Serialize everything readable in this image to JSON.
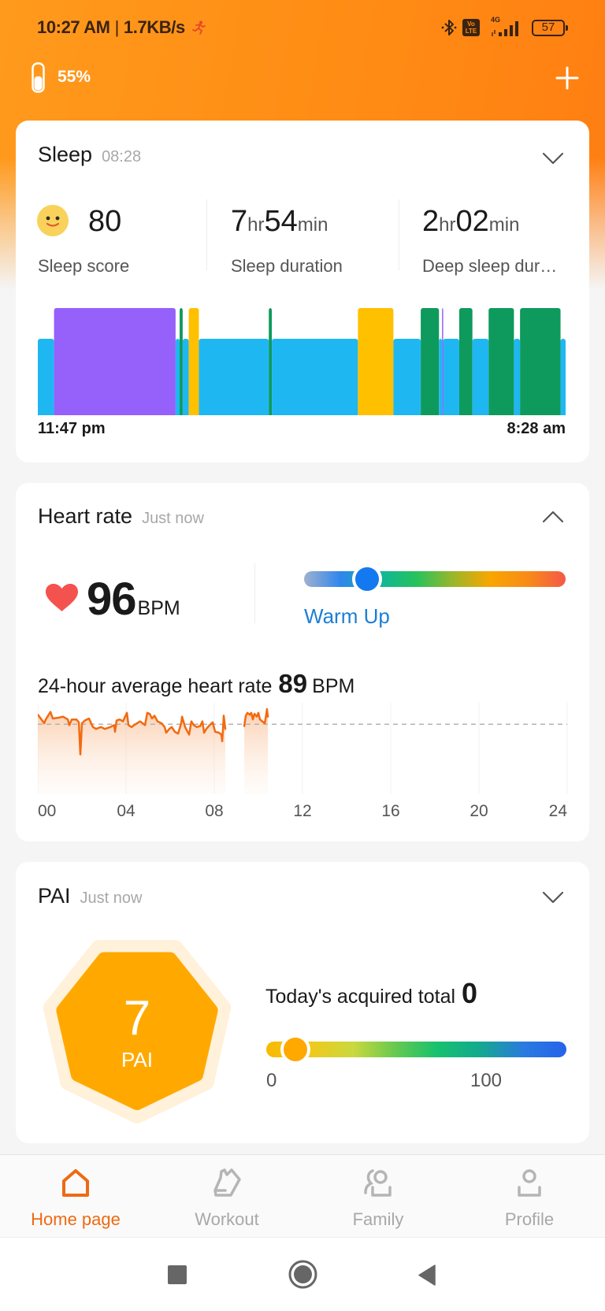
{
  "status_bar": {
    "time": "10:27 AM",
    "separator": "|",
    "net_speed": "1.7KB/s",
    "volte_top": "Vo",
    "volte_bottom": "LTE",
    "network_type": "4G",
    "battery_level": "57"
  },
  "header": {
    "band_battery": "55%",
    "band_battery_fraction": 0.55
  },
  "sleep": {
    "title": "Sleep",
    "time": "08:28",
    "score": {
      "value": "80",
      "label": "Sleep score"
    },
    "duration": {
      "hours": "7",
      "hours_unit": "hr",
      "minutes": "54",
      "minutes_unit": "min",
      "label": "Sleep duration"
    },
    "deep_sleep": {
      "hours": "2",
      "hours_unit": "hr",
      "minutes": "02",
      "minutes_unit": "min",
      "label": "Deep sleep dur…"
    },
    "start_label": "11:47 pm",
    "end_label": "8:28 am"
  },
  "heart_rate": {
    "title": "Heart rate",
    "time": "Just now",
    "value": "96",
    "unit": "BPM",
    "zone": "Warm Up",
    "zone_position": 0.24,
    "avg_label": "24-hour average heart rate",
    "avg_value": "89",
    "avg_unit": "BPM"
  },
  "pai": {
    "title": "PAI",
    "time": "Just now",
    "value": "7",
    "label": "PAI",
    "today_label": "Today's acquired total",
    "today_value": "0",
    "scale_min_label": "0",
    "scale_max_label": "100",
    "scale_max": 100,
    "indicator_value": 7
  },
  "bottom_nav": {
    "items": [
      {
        "label": "Home page",
        "icon": "home-icon",
        "active": true
      },
      {
        "label": "Workout",
        "icon": "shoe-icon",
        "active": false
      },
      {
        "label": "Family",
        "icon": "family-icon",
        "active": false
      },
      {
        "label": "Profile",
        "icon": "profile-icon",
        "active": false
      }
    ]
  },
  "colors": {
    "accent": "#EE6A12",
    "inactive": "#A8A8A8",
    "heart": "#F4524E",
    "zone_text": "#1C7ED6",
    "pai_fill": "#FFA900",
    "pai_halo": "#FFF1DA",
    "hr_line": "#F26A10",
    "zone_gradient": [
      "#9FB1CE",
      "#2E86EE",
      "#0FB69A",
      "#27C25C",
      "#9BB62A",
      "#F9A600",
      "#F88A18",
      "#F4584A"
    ],
    "pai_gradient": [
      "#F7BA00",
      "#F2C81A",
      "#C9D93E",
      "#66C94F",
      "#16C16E",
      "#14A98E",
      "#2A7AE0",
      "#2563EB"
    ]
  },
  "chart_data": [
    {
      "id": "sleep_stages",
      "type": "bar",
      "xlabel": "",
      "ylabel": "",
      "x_start_label": "11:47 pm",
      "x_end_label": "8:28 am",
      "x_range_minutes": [
        0,
        521
      ],
      "stage_colors": {
        "light": "#1FB7F2",
        "deep": "#9660FA",
        "rem": "#0E9A5C",
        "awake": "#FFC000"
      },
      "stage_tier": {
        "light": 1,
        "deep": 2,
        "rem": 2,
        "awake": 2
      },
      "segments": [
        {
          "stage": "light",
          "start": 0,
          "end": 16
        },
        {
          "stage": "deep",
          "start": 16,
          "end": 136
        },
        {
          "stage": "light",
          "start": 136,
          "end": 140
        },
        {
          "stage": "rem",
          "start": 140,
          "end": 143
        },
        {
          "stage": "light",
          "start": 143,
          "end": 149
        },
        {
          "stage": "awake",
          "start": 149,
          "end": 159
        },
        {
          "stage": "light",
          "start": 159,
          "end": 228
        },
        {
          "stage": "rem",
          "start": 228,
          "end": 231
        },
        {
          "stage": "light",
          "start": 231,
          "end": 316
        },
        {
          "stage": "awake",
          "start": 316,
          "end": 351
        },
        {
          "stage": "light",
          "start": 351,
          "end": 378
        },
        {
          "stage": "rem",
          "start": 378,
          "end": 396
        },
        {
          "stage": "light",
          "start": 396,
          "end": 399
        },
        {
          "stage": "deep",
          "start": 399,
          "end": 400
        },
        {
          "stage": "light",
          "start": 400,
          "end": 416
        },
        {
          "stage": "rem",
          "start": 416,
          "end": 429
        },
        {
          "stage": "light",
          "start": 429,
          "end": 445
        },
        {
          "stage": "rem",
          "start": 445,
          "end": 470
        },
        {
          "stage": "light",
          "start": 470,
          "end": 476
        },
        {
          "stage": "rem",
          "start": 476,
          "end": 516
        },
        {
          "stage": "light",
          "start": 516,
          "end": 521
        }
      ]
    },
    {
      "id": "heart_rate_24h",
      "type": "line",
      "xlabel": "",
      "ylabel": "",
      "x_ticks": [
        "00",
        "04",
        "08",
        "12",
        "16",
        "20",
        "24"
      ],
      "xlim": [
        0,
        24
      ],
      "ylim": [
        15,
        115
      ],
      "grid": "vertical",
      "average": 89,
      "series": [
        {
          "name": "Heart rate (BPM)",
          "segments": [
            [
              [
                0.0,
                99
              ],
              [
                0.07,
                97
              ],
              [
                0.29,
                90
              ],
              [
                0.36,
                94
              ],
              [
                0.57,
                102
              ],
              [
                0.68,
                95
              ],
              [
                0.96,
                96
              ],
              [
                1.14,
                97
              ],
              [
                1.36,
                94
              ],
              [
                1.43,
                88
              ],
              [
                1.54,
                94
              ],
              [
                1.75,
                94
              ],
              [
                1.86,
                91
              ],
              [
                1.93,
                57
              ],
              [
                2.0,
                90
              ],
              [
                2.14,
                93
              ],
              [
                2.32,
                95
              ],
              [
                2.5,
                86
              ],
              [
                2.64,
                84
              ],
              [
                2.86,
                86
              ],
              [
                3.04,
                84
              ],
              [
                3.29,
                86
              ],
              [
                3.46,
                88
              ],
              [
                3.5,
                81
              ],
              [
                3.57,
                93
              ],
              [
                3.71,
                94
              ],
              [
                3.86,
                92
              ],
              [
                4.04,
                101
              ],
              [
                4.11,
                88
              ],
              [
                4.25,
                86
              ],
              [
                4.43,
                89
              ],
              [
                4.64,
                92
              ],
              [
                4.86,
                88
              ],
              [
                4.96,
                101
              ],
              [
                5.07,
                100
              ],
              [
                5.18,
                95
              ],
              [
                5.29,
                98
              ],
              [
                5.43,
                92
              ],
              [
                5.61,
                90
              ],
              [
                5.75,
                86
              ],
              [
                5.82,
                80
              ],
              [
                5.96,
                84
              ],
              [
                6.07,
                86
              ],
              [
                6.21,
                81
              ],
              [
                6.36,
                79
              ],
              [
                6.5,
                90
              ],
              [
                6.54,
                97
              ],
              [
                6.68,
                86
              ],
              [
                6.79,
                81
              ],
              [
                6.86,
                78
              ],
              [
                6.96,
                92
              ],
              [
                7.07,
                88
              ],
              [
                7.21,
                86
              ],
              [
                7.36,
                87
              ],
              [
                7.46,
                92
              ],
              [
                7.54,
                80
              ],
              [
                7.64,
                84
              ],
              [
                7.79,
                88
              ],
              [
                7.93,
                91
              ],
              [
                8.04,
                81
              ],
              [
                8.21,
                80
              ],
              [
                8.32,
                78
              ],
              [
                8.36,
                71
              ],
              [
                8.39,
                82
              ],
              [
                8.43,
                98
              ],
              [
                8.5,
                84
              ]
            ],
            [
              [
                9.36,
                87
              ],
              [
                9.43,
                98
              ],
              [
                9.5,
                101
              ],
              [
                9.61,
                99
              ],
              [
                9.68,
                101
              ],
              [
                9.75,
                94
              ],
              [
                9.82,
                100
              ],
              [
                9.93,
                97
              ],
              [
                10.0,
                101
              ],
              [
                10.07,
                94
              ],
              [
                10.18,
                92
              ],
              [
                10.29,
                90
              ],
              [
                10.36,
                100
              ],
              [
                10.39,
                105
              ],
              [
                10.43,
                97
              ]
            ]
          ]
        }
      ]
    }
  ]
}
